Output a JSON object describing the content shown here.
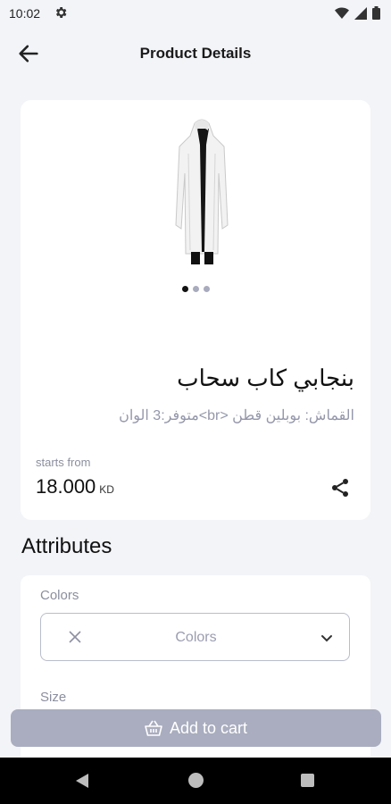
{
  "status_bar": {
    "time": "10:02"
  },
  "app_bar": {
    "title": "Product Details"
  },
  "product": {
    "name": "بنجابي كاب سحاب",
    "description": "القماش: بوبلين قطن <br>متوفر:3 الوان",
    "starts_from_label": "starts from",
    "price": "18.000",
    "currency": "KD",
    "image_count": 3,
    "active_image_index": 0
  },
  "attributes": {
    "title": "Attributes",
    "colors_label": "Colors",
    "colors_placeholder": "Colors",
    "size_label": "Size"
  },
  "cart": {
    "add_label": "Add to cart"
  },
  "icons": [
    "settings-icon",
    "wifi-icon",
    "signal-icon",
    "battery-icon",
    "back-arrow-icon",
    "share-icon",
    "close-icon",
    "chevron-down-icon",
    "basket-icon",
    "nav-back-icon",
    "nav-home-icon",
    "nav-recents-icon"
  ]
}
